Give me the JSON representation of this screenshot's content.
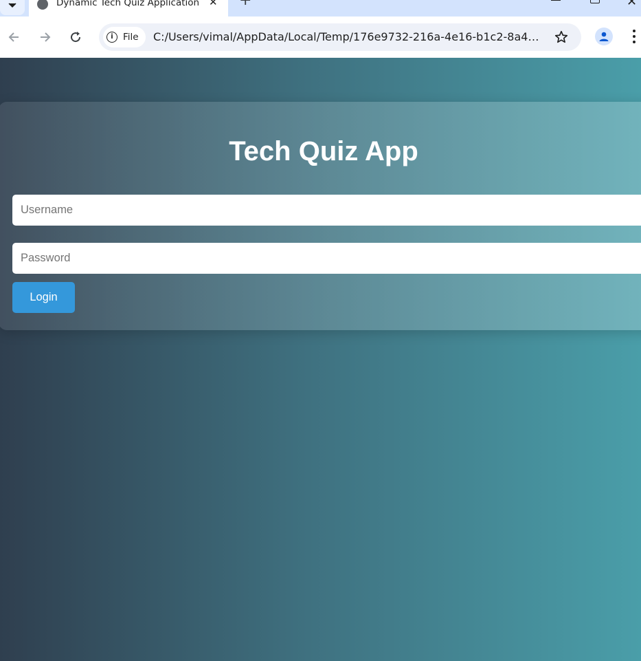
{
  "browser": {
    "tab_title": "Dynamic Tech Quiz Application",
    "tab_close": "✕",
    "new_tab": "+",
    "window_close": "✕",
    "security_chip_label": "File",
    "url": "C:/Users/vimal/AppData/Local/Temp/176e9732-216a-4e16-b1c2-8a46b...",
    "icons": {
      "tab_search": "chevron-down-icon",
      "favicon": "globe-icon",
      "back": "arrow-left-icon",
      "forward": "arrow-right-icon",
      "reload": "reload-icon",
      "site_info": "info-icon",
      "bookmark": "star-icon",
      "profile": "person-icon",
      "menu": "more-vert-icon"
    }
  },
  "app": {
    "title": "Tech Quiz App",
    "username_placeholder": "Username",
    "password_placeholder": "Password",
    "login_label": "Login"
  },
  "colors": {
    "background_start": "#2f3f4f",
    "background_end": "#4a9ea9",
    "login_button": "#3498db",
    "text_on_dark": "#ffffff"
  }
}
